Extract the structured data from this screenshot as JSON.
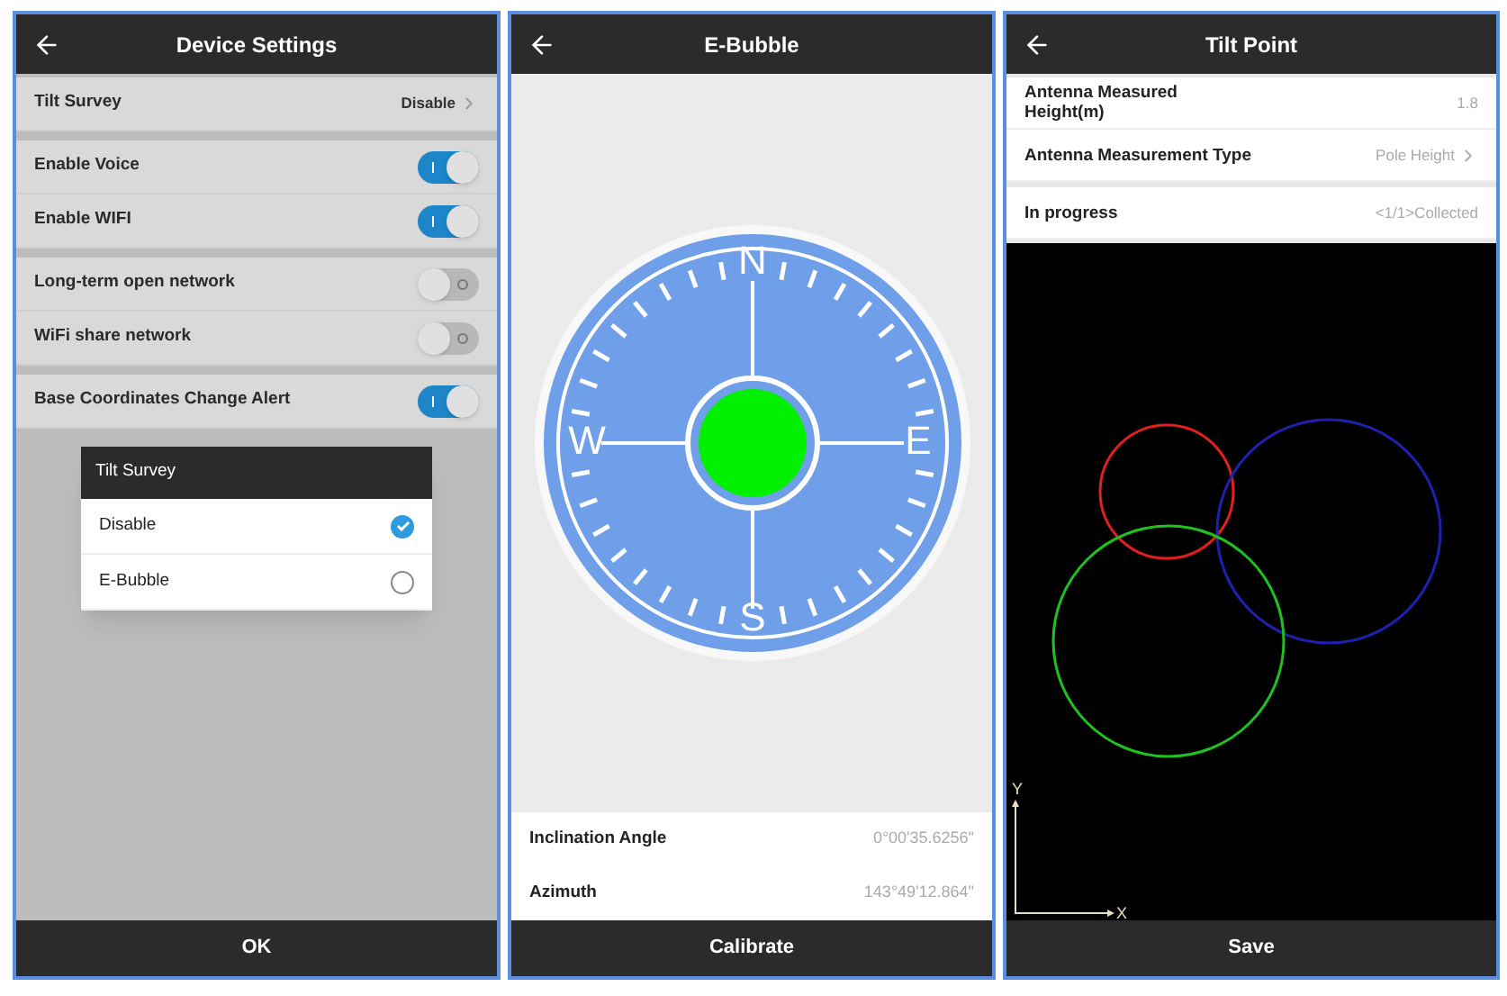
{
  "device_settings": {
    "title": "Device Settings",
    "groups": [
      [
        {
          "kind": "link",
          "label": "Tilt Survey",
          "value": "Disable"
        }
      ],
      [
        {
          "kind": "toggle",
          "label": "Enable Voice",
          "on": true
        },
        {
          "kind": "toggle",
          "label": "Enable WIFI",
          "on": true
        }
      ],
      [
        {
          "kind": "toggle",
          "label": "Long-term open network",
          "on": false
        },
        {
          "kind": "toggle",
          "label": "WiFi share network",
          "on": false
        }
      ],
      [
        {
          "kind": "toggle",
          "label": "Base Coordinates Change Alert",
          "on": true
        }
      ]
    ],
    "dialog": {
      "title": "Tilt Survey",
      "options": [
        {
          "label": "Disable",
          "selected": true
        },
        {
          "label": "E-Bubble",
          "selected": false
        }
      ]
    },
    "footer_button": "OK"
  },
  "e_bubble": {
    "title": "E-Bubble",
    "compass": {
      "north": "N",
      "east": "E",
      "south": "S",
      "west": "W"
    },
    "readings": [
      {
        "label": "Inclination Angle",
        "value": "0°00'35.6256\""
      },
      {
        "label": "Azimuth",
        "value": "143°49'12.864\""
      }
    ],
    "footer_button": "Calibrate"
  },
  "tilt_point": {
    "title": "Tilt Point",
    "groups": [
      [
        {
          "kind": "text",
          "label": "Antenna Measured Height(m)",
          "value": "1.8"
        },
        {
          "kind": "link",
          "label": "Antenna Measurement Type",
          "value": "Pole Height"
        }
      ],
      [
        {
          "kind": "text",
          "label": "In progress",
          "value": "<1/1>Collected"
        }
      ]
    ],
    "plot": {
      "x_label": "X",
      "y_label": "Y"
    },
    "footer_button": "Save"
  }
}
